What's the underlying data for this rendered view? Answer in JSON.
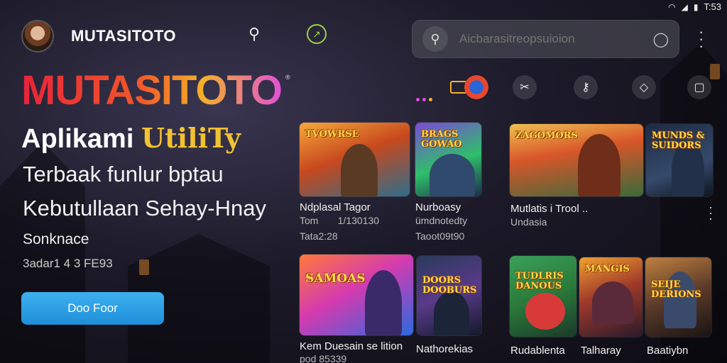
{
  "status": {
    "time": "T:53"
  },
  "header": {
    "brand": "MUTASITOTO",
    "search_placeholder": "Aicbarasitreopsuioion"
  },
  "hero": {
    "logo": "MUTASITOTO",
    "logo_mark": "®",
    "line1_a": "Aplikami ",
    "line1_b": "UtiliTy",
    "line2": "Terbaak funlur bptau",
    "line3": "Kebutullaan Sehay-Hnay",
    "subtitle": "Sonknace",
    "meta": "3adar1 4 3 FE93",
    "cta_label": "Doo Foor"
  },
  "colors": {
    "accent": "#f3b02a",
    "cta": "#2a9fe6",
    "brand_red": "#e8233a"
  },
  "icons": [
    "search-icon",
    "compass-icon",
    "mic-icon",
    "kebab-icon",
    "tools-icon",
    "key-icon",
    "shield-icon",
    "chat-icon"
  ],
  "cards": [
    {
      "art_title": "TVOWRSE",
      "label": "Ndplasal Tagor",
      "sub1": "Tom       1/130130",
      "sub2": "Tata2:28"
    },
    {
      "art_title": "BRAGS\nGOWAO",
      "label": "Nurboasy",
      "sub1": "ümdnotedty",
      "sub2": "Taoot09t90"
    },
    {
      "art_title": "ZAGOMORS",
      "label": "Mutlatis i Trool ..",
      "sub1": "Undasia",
      "sub2": ""
    },
    {
      "art_title": "MUNDS &\nSUIDORS",
      "label": "",
      "sub1": "",
      "sub2": ""
    },
    {
      "art_title": "SAMOAS",
      "label": "Kem Duesain se lition",
      "sub1": "pod 85339",
      "sub2": ""
    },
    {
      "art_title": "DOORS\nDOOBURS",
      "label": "Nathorekias",
      "sub1": "",
      "sub2": ""
    },
    {
      "art_title": "TUDLRIS\nDANOUS",
      "label": "Rudablenta",
      "sub1": "",
      "sub2": ""
    },
    {
      "art_title": "MANGIS",
      "label": "Talharay",
      "sub1": "",
      "sub2": ""
    },
    {
      "art_title": "SEIJE\nDERIONS",
      "label": "Baatiybn",
      "sub1": "",
      "sub2": ""
    }
  ]
}
